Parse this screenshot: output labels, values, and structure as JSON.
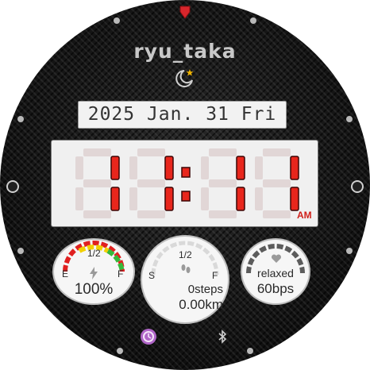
{
  "brand": "ryu_taka",
  "date": "2025 Jan. 31 Fri",
  "time": {
    "hours": "11",
    "minutes": "11",
    "ampm": "AM"
  },
  "battery": {
    "level_label": "1/2",
    "empty": "E",
    "full": "F",
    "percent": "100%",
    "fill": 1.0
  },
  "steps": {
    "level_label": "1/2",
    "start": "S",
    "full": "F",
    "count": "0steps",
    "distance": "0.00km"
  },
  "stress": {
    "status": "relaxed",
    "heart_rate": "60bps"
  },
  "colors": {
    "digit_on": "#e8261c",
    "digit_off": "#e1d6d6",
    "accent_purple": "#b066c8"
  },
  "icons": [
    "moon-star-icon",
    "lightning-icon",
    "footprints-icon",
    "heart-icon",
    "alarm-clock-icon",
    "bluetooth-icon"
  ]
}
